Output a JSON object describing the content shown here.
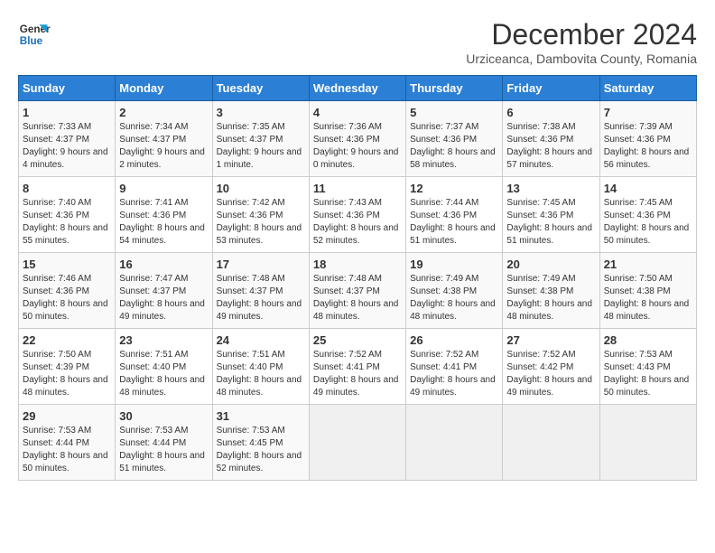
{
  "logo": {
    "line1": "General",
    "line2": "Blue"
  },
  "title": "December 2024",
  "subtitle": "Urziceanca, Dambovita County, Romania",
  "days_of_week": [
    "Sunday",
    "Monday",
    "Tuesday",
    "Wednesday",
    "Thursday",
    "Friday",
    "Saturday"
  ],
  "weeks": [
    [
      {
        "day": "1",
        "sunrise": "7:33 AM",
        "sunset": "4:37 PM",
        "daylight": "9 hours and 4 minutes."
      },
      {
        "day": "2",
        "sunrise": "7:34 AM",
        "sunset": "4:37 PM",
        "daylight": "9 hours and 2 minutes."
      },
      {
        "day": "3",
        "sunrise": "7:35 AM",
        "sunset": "4:37 PM",
        "daylight": "9 hours and 1 minute."
      },
      {
        "day": "4",
        "sunrise": "7:36 AM",
        "sunset": "4:36 PM",
        "daylight": "9 hours and 0 minutes."
      },
      {
        "day": "5",
        "sunrise": "7:37 AM",
        "sunset": "4:36 PM",
        "daylight": "8 hours and 58 minutes."
      },
      {
        "day": "6",
        "sunrise": "7:38 AM",
        "sunset": "4:36 PM",
        "daylight": "8 hours and 57 minutes."
      },
      {
        "day": "7",
        "sunrise": "7:39 AM",
        "sunset": "4:36 PM",
        "daylight": "8 hours and 56 minutes."
      }
    ],
    [
      {
        "day": "8",
        "sunrise": "7:40 AM",
        "sunset": "4:36 PM",
        "daylight": "8 hours and 55 minutes."
      },
      {
        "day": "9",
        "sunrise": "7:41 AM",
        "sunset": "4:36 PM",
        "daylight": "8 hours and 54 minutes."
      },
      {
        "day": "10",
        "sunrise": "7:42 AM",
        "sunset": "4:36 PM",
        "daylight": "8 hours and 53 minutes."
      },
      {
        "day": "11",
        "sunrise": "7:43 AM",
        "sunset": "4:36 PM",
        "daylight": "8 hours and 52 minutes."
      },
      {
        "day": "12",
        "sunrise": "7:44 AM",
        "sunset": "4:36 PM",
        "daylight": "8 hours and 51 minutes."
      },
      {
        "day": "13",
        "sunrise": "7:45 AM",
        "sunset": "4:36 PM",
        "daylight": "8 hours and 51 minutes."
      },
      {
        "day": "14",
        "sunrise": "7:45 AM",
        "sunset": "4:36 PM",
        "daylight": "8 hours and 50 minutes."
      }
    ],
    [
      {
        "day": "15",
        "sunrise": "7:46 AM",
        "sunset": "4:36 PM",
        "daylight": "8 hours and 50 minutes."
      },
      {
        "day": "16",
        "sunrise": "7:47 AM",
        "sunset": "4:37 PM",
        "daylight": "8 hours and 49 minutes."
      },
      {
        "day": "17",
        "sunrise": "7:48 AM",
        "sunset": "4:37 PM",
        "daylight": "8 hours and 49 minutes."
      },
      {
        "day": "18",
        "sunrise": "7:48 AM",
        "sunset": "4:37 PM",
        "daylight": "8 hours and 48 minutes."
      },
      {
        "day": "19",
        "sunrise": "7:49 AM",
        "sunset": "4:38 PM",
        "daylight": "8 hours and 48 minutes."
      },
      {
        "day": "20",
        "sunrise": "7:49 AM",
        "sunset": "4:38 PM",
        "daylight": "8 hours and 48 minutes."
      },
      {
        "day": "21",
        "sunrise": "7:50 AM",
        "sunset": "4:38 PM",
        "daylight": "8 hours and 48 minutes."
      }
    ],
    [
      {
        "day": "22",
        "sunrise": "7:50 AM",
        "sunset": "4:39 PM",
        "daylight": "8 hours and 48 minutes."
      },
      {
        "day": "23",
        "sunrise": "7:51 AM",
        "sunset": "4:40 PM",
        "daylight": "8 hours and 48 minutes."
      },
      {
        "day": "24",
        "sunrise": "7:51 AM",
        "sunset": "4:40 PM",
        "daylight": "8 hours and 48 minutes."
      },
      {
        "day": "25",
        "sunrise": "7:52 AM",
        "sunset": "4:41 PM",
        "daylight": "8 hours and 49 minutes."
      },
      {
        "day": "26",
        "sunrise": "7:52 AM",
        "sunset": "4:41 PM",
        "daylight": "8 hours and 49 minutes."
      },
      {
        "day": "27",
        "sunrise": "7:52 AM",
        "sunset": "4:42 PM",
        "daylight": "8 hours and 49 minutes."
      },
      {
        "day": "28",
        "sunrise": "7:53 AM",
        "sunset": "4:43 PM",
        "daylight": "8 hours and 50 minutes."
      }
    ],
    [
      {
        "day": "29",
        "sunrise": "7:53 AM",
        "sunset": "4:44 PM",
        "daylight": "8 hours and 50 minutes."
      },
      {
        "day": "30",
        "sunrise": "7:53 AM",
        "sunset": "4:44 PM",
        "daylight": "8 hours and 51 minutes."
      },
      {
        "day": "31",
        "sunrise": "7:53 AM",
        "sunset": "4:45 PM",
        "daylight": "8 hours and 52 minutes."
      },
      null,
      null,
      null,
      null
    ]
  ]
}
